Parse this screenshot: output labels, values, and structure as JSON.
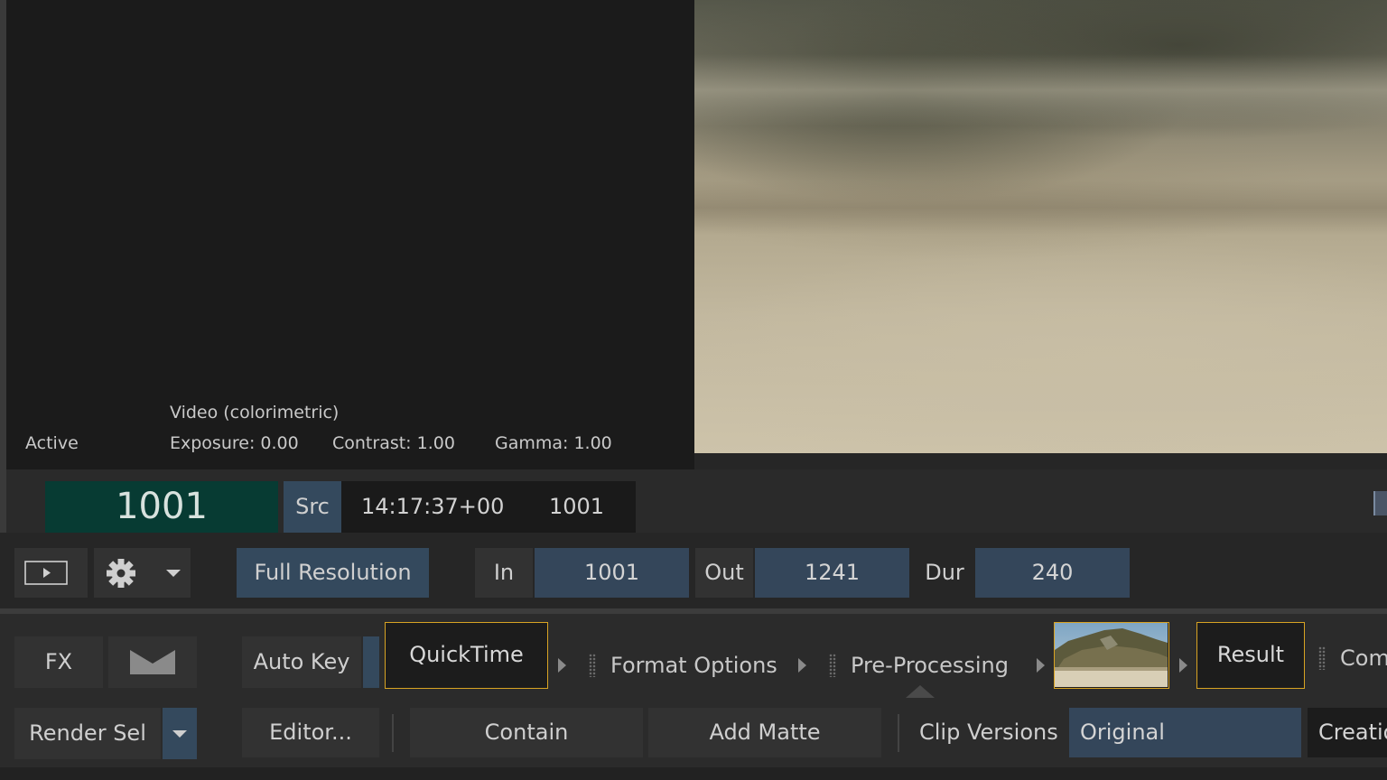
{
  "info_panel": {
    "status": "Active",
    "colorspace": "Video (colorimetric)",
    "exposure": "Exposure: 0.00",
    "contrast": "Contrast: 1.00",
    "gamma": "Gamma: 1.00"
  },
  "timecode": {
    "frame": "1001",
    "src_label": "Src",
    "timecode": "14:17:37+00",
    "src_frame": "1001"
  },
  "controls": {
    "resolution": "Full Resolution",
    "in_label": "In",
    "in_value": "1001",
    "out_label": "Out",
    "out_value": "1241",
    "dur_label": "Dur",
    "dur_value": "240"
  },
  "pipeline": {
    "fx_label": "FX",
    "autokey_label": "Auto Key",
    "quicktime_label": "QuickTime",
    "format_options_label": "Format Options",
    "preprocessing_label": "Pre-Processing",
    "result_label": "Result",
    "comp_label": "Comp"
  },
  "bottom_row": {
    "render_sel_label": "Render Sel",
    "editor_label": "Editor...",
    "contain_label": "Contain",
    "add_matte_label": "Add Matte",
    "clip_versions_label": "Clip Versions",
    "clip_version_value": "Original",
    "creation_label": "Creatio"
  },
  "colors": {
    "frame_display_bg": "#073b33",
    "accent_blue": "#34495d",
    "node_highlight": "#d8a323"
  }
}
